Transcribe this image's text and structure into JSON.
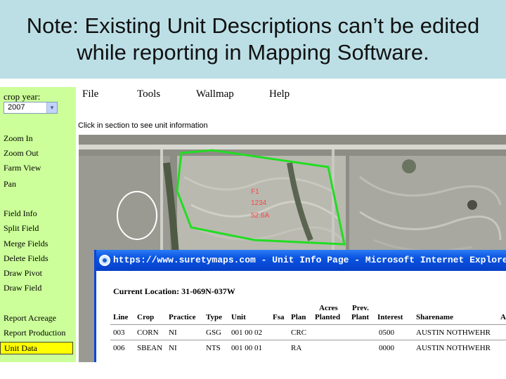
{
  "slide": {
    "note_line1": "Note: Existing Unit Descriptions can’t be edited",
    "note_line2": "while reporting in Mapping Software."
  },
  "sidebar": {
    "crop_year_label": "crop year:",
    "crop_year_value": "2007",
    "items": [
      "Zoom In",
      "Zoom Out",
      "Farm View",
      "Pan",
      "Field Info",
      "Split Field",
      "Merge Fields",
      "Delete Fields",
      "Draw Pivot",
      "Draw Field",
      "Report Acreage",
      "Report Production",
      "Unit Data"
    ]
  },
  "menubar": {
    "items": [
      "File",
      "Tools",
      "Wallmap",
      "Help"
    ]
  },
  "info_bar": {
    "text": "Click in section to see unit information"
  },
  "map": {
    "field_label": {
      "line1": "F1",
      "line2": "1234",
      "line3": "52.6A"
    },
    "colors": {
      "field_outline": "#22dd22",
      "pivot_outline": "#ffffff",
      "label": "#ff4444"
    }
  },
  "ie_window": {
    "title": "https://www.suretymaps.com - Unit Info Page - Microsoft Internet Explorer",
    "current_location": "Current Location: 31-069N-037W",
    "headers": {
      "line": "Line",
      "crop": "Crop",
      "practice": "Practice",
      "type": "Type",
      "unit": "Unit",
      "fsa": "Fsa",
      "plan": "Plan",
      "acres_top": "Acres",
      "acres_bottom": "Planted",
      "prev_top": "Prev.",
      "prev_bottom": "Plant",
      "interest": "Interest",
      "sharename": "Sharename",
      "last": "A"
    },
    "rows": [
      {
        "line": "003",
        "crop": "CORN",
        "practice": "NI",
        "type": "GSG",
        "unit": "001 00 02",
        "plan": "CRC",
        "interest": "0500",
        "sharename": "AUSTIN NOTHWEHR"
      },
      {
        "line": "006",
        "crop": "SBEAN",
        "practice": "NI",
        "type": "NTS",
        "unit": "001 00 01",
        "plan": "RA",
        "interest": "0000",
        "sharename": "AUSTIN NOTHWEHR"
      }
    ],
    "colors": {
      "titlebar": "#0a53e0"
    }
  }
}
